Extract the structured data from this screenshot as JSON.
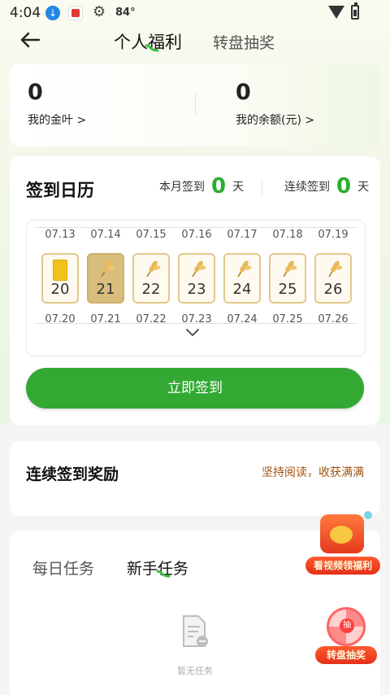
{
  "status_bar": {
    "time": "4:04",
    "temperature": "84°",
    "download_glyph": "↓",
    "gear_glyph": "⚙"
  },
  "header": {
    "active_tab": "个人福利",
    "other_tab": "转盘抽奖"
  },
  "assets": [
    {
      "value": "0",
      "label": "我的金叶 >"
    },
    {
      "value": "0",
      "label": "我的余额(元) >"
    }
  ],
  "calendar": {
    "title": "签到日历",
    "month_label": "本月签到",
    "month_count": "0",
    "month_unit": "天",
    "streak_label": "连续签到",
    "streak_count": "0",
    "streak_unit": "天",
    "top_dates": [
      "07.13",
      "07.14",
      "07.15",
      "07.16",
      "07.17",
      "07.18",
      "07.19"
    ],
    "days": [
      "20",
      "21",
      "22",
      "23",
      "24",
      "25",
      "26"
    ],
    "bottom_dates": [
      "07.20",
      "07.21",
      "07.22",
      "07.23",
      "07.24",
      "07.25",
      "07.26"
    ],
    "sign_button": "立即签到"
  },
  "streak_section": {
    "title": "连续签到奖励",
    "hint": "坚持阅读，收获满满"
  },
  "tasks": {
    "tab_daily": "每日任务",
    "tab_new": "新手任务",
    "empty_text": "暂无任务"
  },
  "floats": {
    "video_reward": "看视频领福利",
    "wheel": "转盘抽奖",
    "wheel_hub": "抽"
  },
  "colors": {
    "accent_green": "#33a934",
    "count_green": "#2bae2f",
    "hint_brown": "#a0520f",
    "gold": "#d9bd7c"
  }
}
